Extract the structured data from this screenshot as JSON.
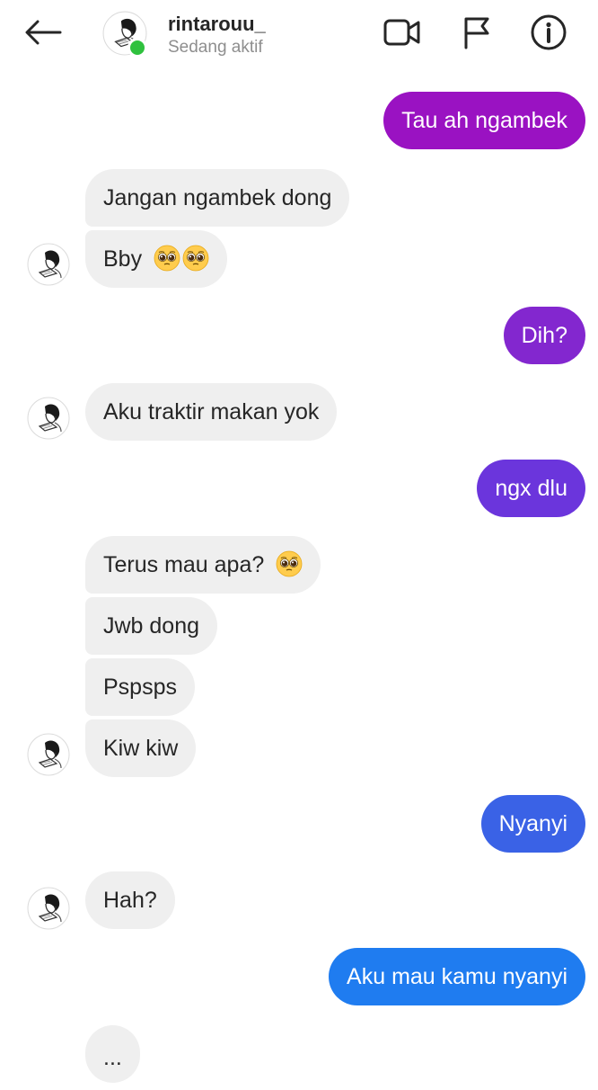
{
  "header": {
    "username": "rintarouu_",
    "status": "Sedang aktif"
  },
  "icons": {
    "back": "back-arrow-icon",
    "video": "video-camera-icon",
    "flag": "flag-icon",
    "info": "info-icon"
  },
  "colors": {
    "incoming_bg": "#efefef",
    "online": "#2fc13e",
    "out_gradient": [
      "#9a12c2",
      "#8327cf",
      "#6b35dc",
      "#3a62e6",
      "#2f6ee8",
      "#1f7cf0"
    ]
  },
  "messages": [
    {
      "from": "me",
      "text": "Tau ah ngambek"
    },
    {
      "from": "them",
      "text": "Jangan ngambek dong"
    },
    {
      "from": "them",
      "text": "Bby",
      "emoji": "pleading-face-emoji",
      "emoji_count": 2
    },
    {
      "from": "me",
      "text": "Dih?"
    },
    {
      "from": "them",
      "text": "Aku traktir makan yok"
    },
    {
      "from": "me",
      "text": "ngx dlu"
    },
    {
      "from": "them",
      "text": "Terus mau apa?",
      "emoji": "pleading-face-emoji",
      "emoji_count": 1
    },
    {
      "from": "them",
      "text": "Jwb dong"
    },
    {
      "from": "them",
      "text": "Pspsps"
    },
    {
      "from": "them",
      "text": "Kiw kiw"
    },
    {
      "from": "me",
      "text": "Nyanyi"
    },
    {
      "from": "them",
      "text": "Hah?"
    },
    {
      "from": "me",
      "text": "Aku mau kamu nyanyi"
    },
    {
      "from": "them",
      "text": "..."
    }
  ]
}
